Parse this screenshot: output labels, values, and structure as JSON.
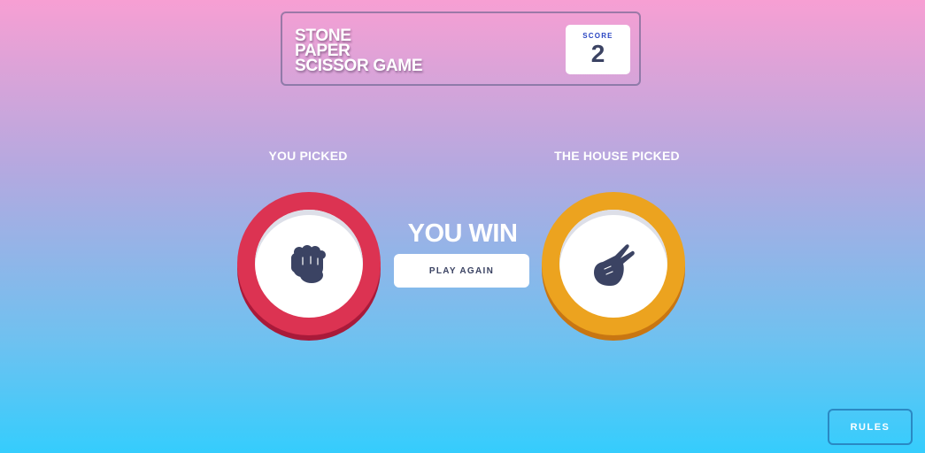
{
  "header": {
    "title_lines": [
      "STONE",
      "PAPER",
      "SCISSOR GAME"
    ],
    "score_label": "SCORE",
    "score_value": "2"
  },
  "player": {
    "label": "YOU PICKED",
    "choice": "rock",
    "icon": "rock-hand-icon",
    "ring_color": "#dc3352"
  },
  "house": {
    "label": "THE HOUSE PICKED",
    "choice": "scissors",
    "icon": "scissors-hand-icon",
    "ring_color": "#eca31f"
  },
  "result": {
    "text": "YOU WIN",
    "play_again_label": "PLAY AGAIN"
  },
  "footer": {
    "rules_label": "RULES"
  }
}
